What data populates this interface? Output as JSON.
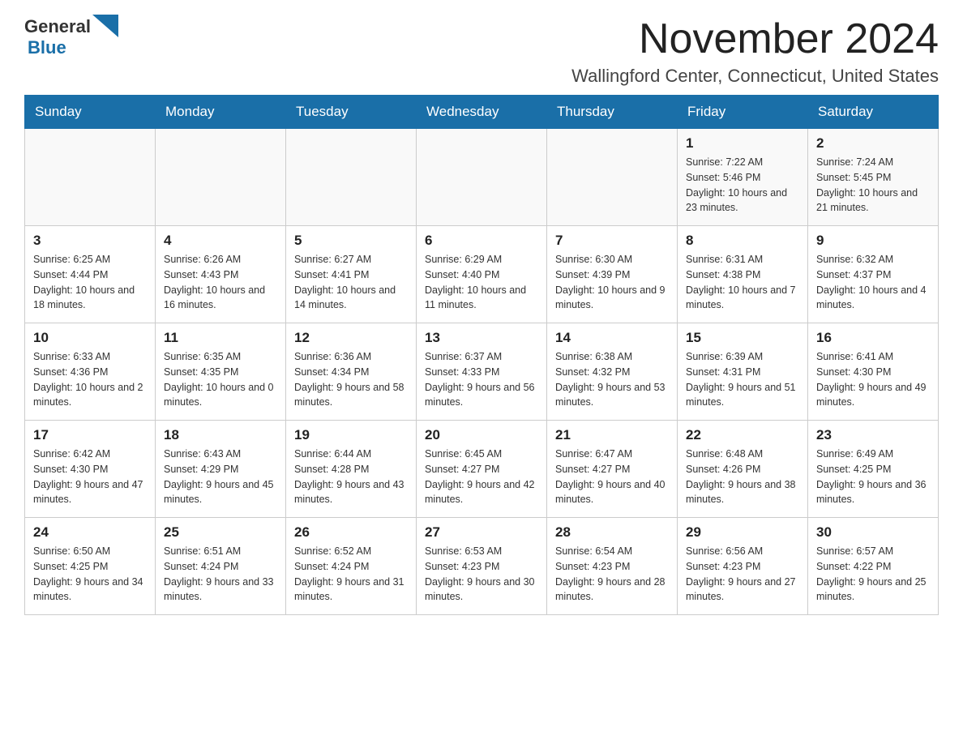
{
  "logo": {
    "general": "General",
    "blue": "Blue"
  },
  "header": {
    "month": "November 2024",
    "location": "Wallingford Center, Connecticut, United States"
  },
  "weekdays": [
    "Sunday",
    "Monday",
    "Tuesday",
    "Wednesday",
    "Thursday",
    "Friday",
    "Saturday"
  ],
  "weeks": [
    [
      {
        "day": "",
        "sunrise": "",
        "sunset": "",
        "daylight": ""
      },
      {
        "day": "",
        "sunrise": "",
        "sunset": "",
        "daylight": ""
      },
      {
        "day": "",
        "sunrise": "",
        "sunset": "",
        "daylight": ""
      },
      {
        "day": "",
        "sunrise": "",
        "sunset": "",
        "daylight": ""
      },
      {
        "day": "",
        "sunrise": "",
        "sunset": "",
        "daylight": ""
      },
      {
        "day": "1",
        "sunrise": "Sunrise: 7:22 AM",
        "sunset": "Sunset: 5:46 PM",
        "daylight": "Daylight: 10 hours and 23 minutes."
      },
      {
        "day": "2",
        "sunrise": "Sunrise: 7:24 AM",
        "sunset": "Sunset: 5:45 PM",
        "daylight": "Daylight: 10 hours and 21 minutes."
      }
    ],
    [
      {
        "day": "3",
        "sunrise": "Sunrise: 6:25 AM",
        "sunset": "Sunset: 4:44 PM",
        "daylight": "Daylight: 10 hours and 18 minutes."
      },
      {
        "day": "4",
        "sunrise": "Sunrise: 6:26 AM",
        "sunset": "Sunset: 4:43 PM",
        "daylight": "Daylight: 10 hours and 16 minutes."
      },
      {
        "day": "5",
        "sunrise": "Sunrise: 6:27 AM",
        "sunset": "Sunset: 4:41 PM",
        "daylight": "Daylight: 10 hours and 14 minutes."
      },
      {
        "day": "6",
        "sunrise": "Sunrise: 6:29 AM",
        "sunset": "Sunset: 4:40 PM",
        "daylight": "Daylight: 10 hours and 11 minutes."
      },
      {
        "day": "7",
        "sunrise": "Sunrise: 6:30 AM",
        "sunset": "Sunset: 4:39 PM",
        "daylight": "Daylight: 10 hours and 9 minutes."
      },
      {
        "day": "8",
        "sunrise": "Sunrise: 6:31 AM",
        "sunset": "Sunset: 4:38 PM",
        "daylight": "Daylight: 10 hours and 7 minutes."
      },
      {
        "day": "9",
        "sunrise": "Sunrise: 6:32 AM",
        "sunset": "Sunset: 4:37 PM",
        "daylight": "Daylight: 10 hours and 4 minutes."
      }
    ],
    [
      {
        "day": "10",
        "sunrise": "Sunrise: 6:33 AM",
        "sunset": "Sunset: 4:36 PM",
        "daylight": "Daylight: 10 hours and 2 minutes."
      },
      {
        "day": "11",
        "sunrise": "Sunrise: 6:35 AM",
        "sunset": "Sunset: 4:35 PM",
        "daylight": "Daylight: 10 hours and 0 minutes."
      },
      {
        "day": "12",
        "sunrise": "Sunrise: 6:36 AM",
        "sunset": "Sunset: 4:34 PM",
        "daylight": "Daylight: 9 hours and 58 minutes."
      },
      {
        "day": "13",
        "sunrise": "Sunrise: 6:37 AM",
        "sunset": "Sunset: 4:33 PM",
        "daylight": "Daylight: 9 hours and 56 minutes."
      },
      {
        "day": "14",
        "sunrise": "Sunrise: 6:38 AM",
        "sunset": "Sunset: 4:32 PM",
        "daylight": "Daylight: 9 hours and 53 minutes."
      },
      {
        "day": "15",
        "sunrise": "Sunrise: 6:39 AM",
        "sunset": "Sunset: 4:31 PM",
        "daylight": "Daylight: 9 hours and 51 minutes."
      },
      {
        "day": "16",
        "sunrise": "Sunrise: 6:41 AM",
        "sunset": "Sunset: 4:30 PM",
        "daylight": "Daylight: 9 hours and 49 minutes."
      }
    ],
    [
      {
        "day": "17",
        "sunrise": "Sunrise: 6:42 AM",
        "sunset": "Sunset: 4:30 PM",
        "daylight": "Daylight: 9 hours and 47 minutes."
      },
      {
        "day": "18",
        "sunrise": "Sunrise: 6:43 AM",
        "sunset": "Sunset: 4:29 PM",
        "daylight": "Daylight: 9 hours and 45 minutes."
      },
      {
        "day": "19",
        "sunrise": "Sunrise: 6:44 AM",
        "sunset": "Sunset: 4:28 PM",
        "daylight": "Daylight: 9 hours and 43 minutes."
      },
      {
        "day": "20",
        "sunrise": "Sunrise: 6:45 AM",
        "sunset": "Sunset: 4:27 PM",
        "daylight": "Daylight: 9 hours and 42 minutes."
      },
      {
        "day": "21",
        "sunrise": "Sunrise: 6:47 AM",
        "sunset": "Sunset: 4:27 PM",
        "daylight": "Daylight: 9 hours and 40 minutes."
      },
      {
        "day": "22",
        "sunrise": "Sunrise: 6:48 AM",
        "sunset": "Sunset: 4:26 PM",
        "daylight": "Daylight: 9 hours and 38 minutes."
      },
      {
        "day": "23",
        "sunrise": "Sunrise: 6:49 AM",
        "sunset": "Sunset: 4:25 PM",
        "daylight": "Daylight: 9 hours and 36 minutes."
      }
    ],
    [
      {
        "day": "24",
        "sunrise": "Sunrise: 6:50 AM",
        "sunset": "Sunset: 4:25 PM",
        "daylight": "Daylight: 9 hours and 34 minutes."
      },
      {
        "day": "25",
        "sunrise": "Sunrise: 6:51 AM",
        "sunset": "Sunset: 4:24 PM",
        "daylight": "Daylight: 9 hours and 33 minutes."
      },
      {
        "day": "26",
        "sunrise": "Sunrise: 6:52 AM",
        "sunset": "Sunset: 4:24 PM",
        "daylight": "Daylight: 9 hours and 31 minutes."
      },
      {
        "day": "27",
        "sunrise": "Sunrise: 6:53 AM",
        "sunset": "Sunset: 4:23 PM",
        "daylight": "Daylight: 9 hours and 30 minutes."
      },
      {
        "day": "28",
        "sunrise": "Sunrise: 6:54 AM",
        "sunset": "Sunset: 4:23 PM",
        "daylight": "Daylight: 9 hours and 28 minutes."
      },
      {
        "day": "29",
        "sunrise": "Sunrise: 6:56 AM",
        "sunset": "Sunset: 4:23 PM",
        "daylight": "Daylight: 9 hours and 27 minutes."
      },
      {
        "day": "30",
        "sunrise": "Sunrise: 6:57 AM",
        "sunset": "Sunset: 4:22 PM",
        "daylight": "Daylight: 9 hours and 25 minutes."
      }
    ]
  ]
}
